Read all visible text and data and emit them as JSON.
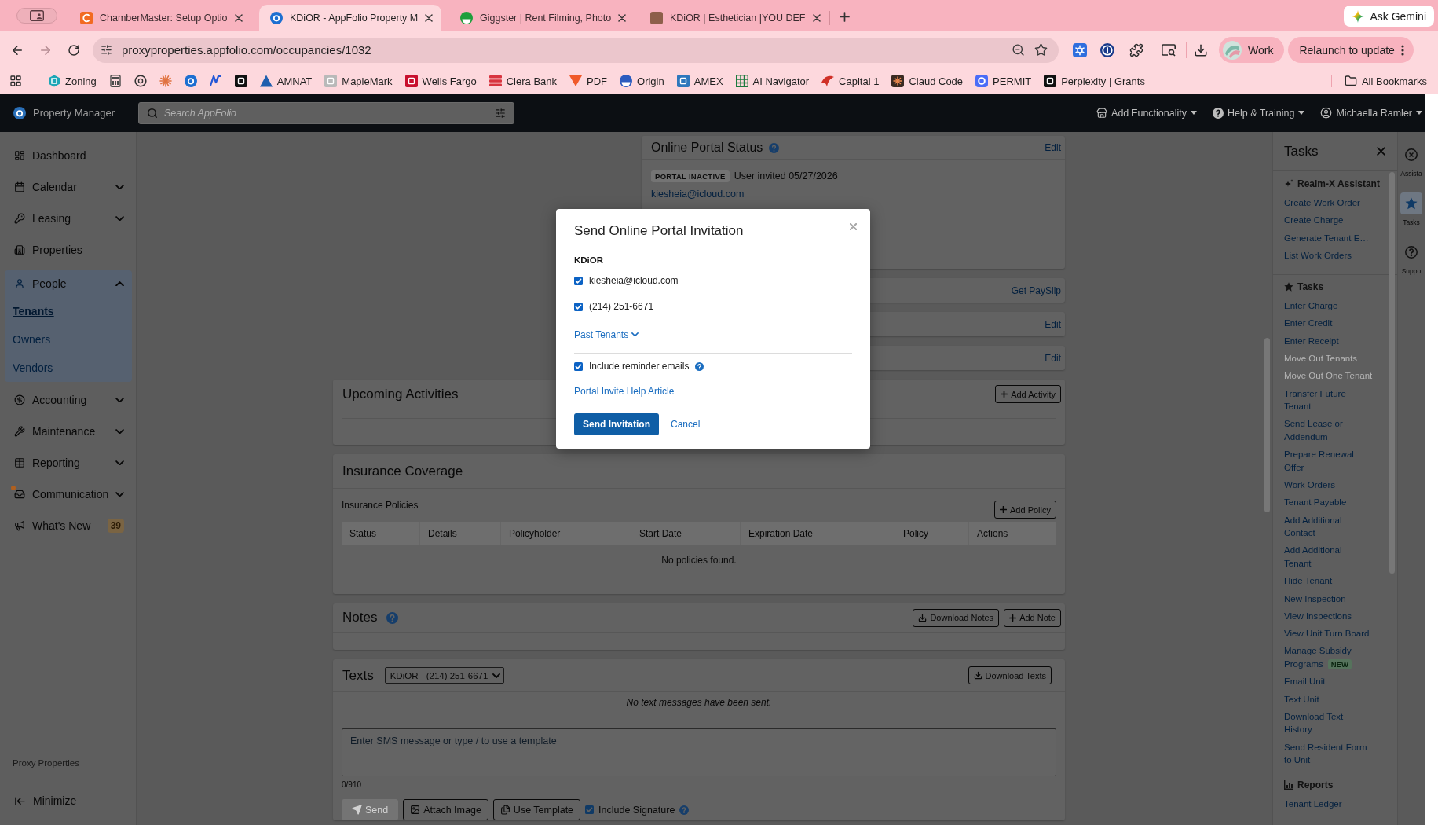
{
  "browser": {
    "tabs": [
      {
        "title": "ChamberMaster: Setup Optio",
        "selected": false
      },
      {
        "title": "KDiOR - AppFolio Property M",
        "selected": true
      },
      {
        "title": "Giggster | Rent Filming, Photo",
        "selected": false
      },
      {
        "title": "KDiOR | Esthetician |YOU DEF",
        "selected": false
      }
    ],
    "gemini_button": "Ask Gemini",
    "url": "proxyproperties.appfolio.com/occupancies/1032",
    "profile_button": "Work",
    "relaunch_button": "Relaunch to update",
    "bookmarks": [
      {
        "kind": "labeled",
        "label": "Zoning"
      },
      {
        "kind": "icon"
      },
      {
        "kind": "icon"
      },
      {
        "kind": "icon"
      },
      {
        "kind": "icon"
      },
      {
        "kind": "icon"
      },
      {
        "kind": "icon"
      },
      {
        "kind": "labeled",
        "label": "AMNAT"
      },
      {
        "kind": "labeled",
        "label": "MapleMark"
      },
      {
        "kind": "labeled",
        "label": "Wells Fargo"
      },
      {
        "kind": "labeled",
        "label": "Ciera Bank"
      },
      {
        "kind": "labeled",
        "label": "PDF"
      },
      {
        "kind": "labeled",
        "label": "Origin"
      },
      {
        "kind": "labeled",
        "label": "AMEX"
      },
      {
        "kind": "labeled",
        "label": "AI Navigator"
      },
      {
        "kind": "labeled",
        "label": "Capital 1"
      },
      {
        "kind": "labeled",
        "label": "Claud Code"
      },
      {
        "kind": "labeled",
        "label": "PERMIT"
      },
      {
        "kind": "labeled",
        "label": "Perplexity | Grants"
      }
    ],
    "all_bookmarks": "All Bookmarks"
  },
  "app_header": {
    "product": "Property Manager",
    "search": {
      "placeholder": "Search AppFolio"
    },
    "menus": [
      "Add Functionality",
      "Help & Training",
      "Michaella Ramler"
    ]
  },
  "sidebar": {
    "items": [
      {
        "kind": "link",
        "label": "Dashboard",
        "notification": false
      },
      {
        "kind": "menu",
        "label": "Calendar",
        "expanded": false,
        "notification": false
      },
      {
        "kind": "menu",
        "label": "Leasing",
        "expanded": false,
        "notification": false
      },
      {
        "kind": "link",
        "label": "Properties",
        "notification": false
      },
      {
        "kind": "menu",
        "label": "People",
        "expanded": true,
        "notification": false,
        "children": [
          {
            "label": "Tenants",
            "selected": true
          },
          {
            "label": "Owners",
            "selected": false
          },
          {
            "label": "Vendors",
            "selected": false
          }
        ]
      },
      {
        "kind": "menu",
        "label": "Accounting",
        "expanded": false,
        "notification": false
      },
      {
        "kind": "menu",
        "label": "Maintenance",
        "expanded": false,
        "notification": false
      },
      {
        "kind": "menu",
        "label": "Reporting",
        "expanded": false,
        "notification": false
      },
      {
        "kind": "menu",
        "label": "Communication",
        "expanded": false,
        "notification": true
      },
      {
        "kind": "link",
        "label": "What's New",
        "notification": false,
        "badge": "39"
      }
    ],
    "company": "Proxy Properties",
    "minimize": "Minimize"
  },
  "portal_status": {
    "title": "Online Portal Status",
    "edit_link": "Edit",
    "status_badge": "PORTAL INACTIVE",
    "invited": "User invited 05/27/2026",
    "email": "kiesheia@icloud.com"
  },
  "side_cards": [
    {
      "link": "Get PaySlip"
    },
    {
      "link": "Edit"
    },
    {
      "link": "Edit"
    }
  ],
  "upcoming_activities": {
    "title": "Upcoming Activities",
    "add_button": "Add Activity"
  },
  "insurance": {
    "title": "Insurance Coverage",
    "subtitle": "Insurance Policies",
    "add_button": "Add Policy",
    "columns": [
      "Status",
      "Details",
      "Policyholder",
      "Start Date",
      "Expiration Date",
      "Policy",
      "Actions"
    ],
    "empty_message": "No policies found."
  },
  "notes": {
    "title": "Notes",
    "buttons": [
      {
        "kind": "download",
        "label": "Download Notes"
      },
      {
        "kind": "add",
        "label": "Add Note"
      }
    ]
  },
  "texts": {
    "title": "Texts",
    "recipient": "KDiOR - (214) 251-6671",
    "download_button": "Download Texts",
    "empty_message": "No text messages have been sent.",
    "message": {
      "placeholder": "Enter SMS message or type / to use a template"
    },
    "counter": "0/910",
    "actions": [
      {
        "kind": "send",
        "label": "Send",
        "disabled": true
      },
      {
        "kind": "image",
        "label": "Attach Image",
        "disabled": false
      },
      {
        "kind": "template",
        "label": "Use Template",
        "disabled": false
      }
    ],
    "signature": {
      "label": "Include Signature",
      "checked": true
    }
  },
  "tasks_panel": {
    "title": "Tasks",
    "sections": [
      {
        "kind": "assistant",
        "title": "Realm-X Assistant",
        "items": [
          {
            "label": "Create Work Order",
            "disabled": false
          },
          {
            "label": "Create Charge",
            "disabled": false
          },
          {
            "label": "Generate Tenant E…",
            "disabled": false
          },
          {
            "label": "List Work Orders",
            "disabled": false
          }
        ]
      },
      {
        "kind": "tasks",
        "title": "Tasks",
        "items": [
          {
            "label": "Enter Charge",
            "disabled": false
          },
          {
            "label": "Enter Credit",
            "disabled": false
          },
          {
            "label": "Enter Receipt",
            "disabled": false
          },
          {
            "label": "Move Out Tenants",
            "disabled": true
          },
          {
            "label": "Move Out One Tenant",
            "disabled": true
          },
          {
            "label": "Transfer Future\nTenant",
            "disabled": false
          },
          {
            "label": "Send Lease or\nAddendum",
            "disabled": false
          },
          {
            "label": "Prepare Renewal\nOffer",
            "disabled": false
          },
          {
            "label": "Work Orders",
            "disabled": false
          },
          {
            "label": "Tenant Payable",
            "disabled": false
          },
          {
            "label": "Add Additional\nContact",
            "disabled": false
          },
          {
            "label": "Add Additional\nTenant",
            "disabled": false
          },
          {
            "label": "Hide Tenant",
            "disabled": false
          },
          {
            "label": "New Inspection",
            "disabled": false
          },
          {
            "label": "View Inspections",
            "disabled": false
          },
          {
            "label": "View Unit Turn Board",
            "disabled": false
          },
          {
            "label": "Manage Subsidy\nPrograms",
            "disabled": false,
            "badge": "NEW"
          },
          {
            "label": "Email Unit",
            "disabled": false
          },
          {
            "label": "Text Unit",
            "disabled": false
          },
          {
            "label": "Download Text\nHistory",
            "disabled": false
          },
          {
            "label": "Send Resident Form\nto Unit",
            "disabled": false
          }
        ]
      },
      {
        "kind": "reports",
        "title": "Reports",
        "items": [
          {
            "label": "Tenant Ledger",
            "disabled": false
          }
        ]
      }
    ]
  },
  "right_rail": [
    {
      "label": "Assista",
      "selected": false
    },
    {
      "label": "Tasks",
      "selected": true
    },
    {
      "label": "Suppo",
      "selected": false
    }
  ],
  "modal": {
    "title": "Send Online Portal Invitation",
    "tenant": "KDiOR",
    "contacts": [
      {
        "label": "kiesheia@icloud.com",
        "checked": true
      },
      {
        "label": "(214) 251-6671",
        "checked": true
      }
    ],
    "past_tenants": "Past Tenants",
    "reminder": {
      "label": "Include reminder emails",
      "checked": true
    },
    "help_link": "Portal Invite Help Article",
    "primary_button": "Send Invitation",
    "cancel": "Cancel"
  }
}
